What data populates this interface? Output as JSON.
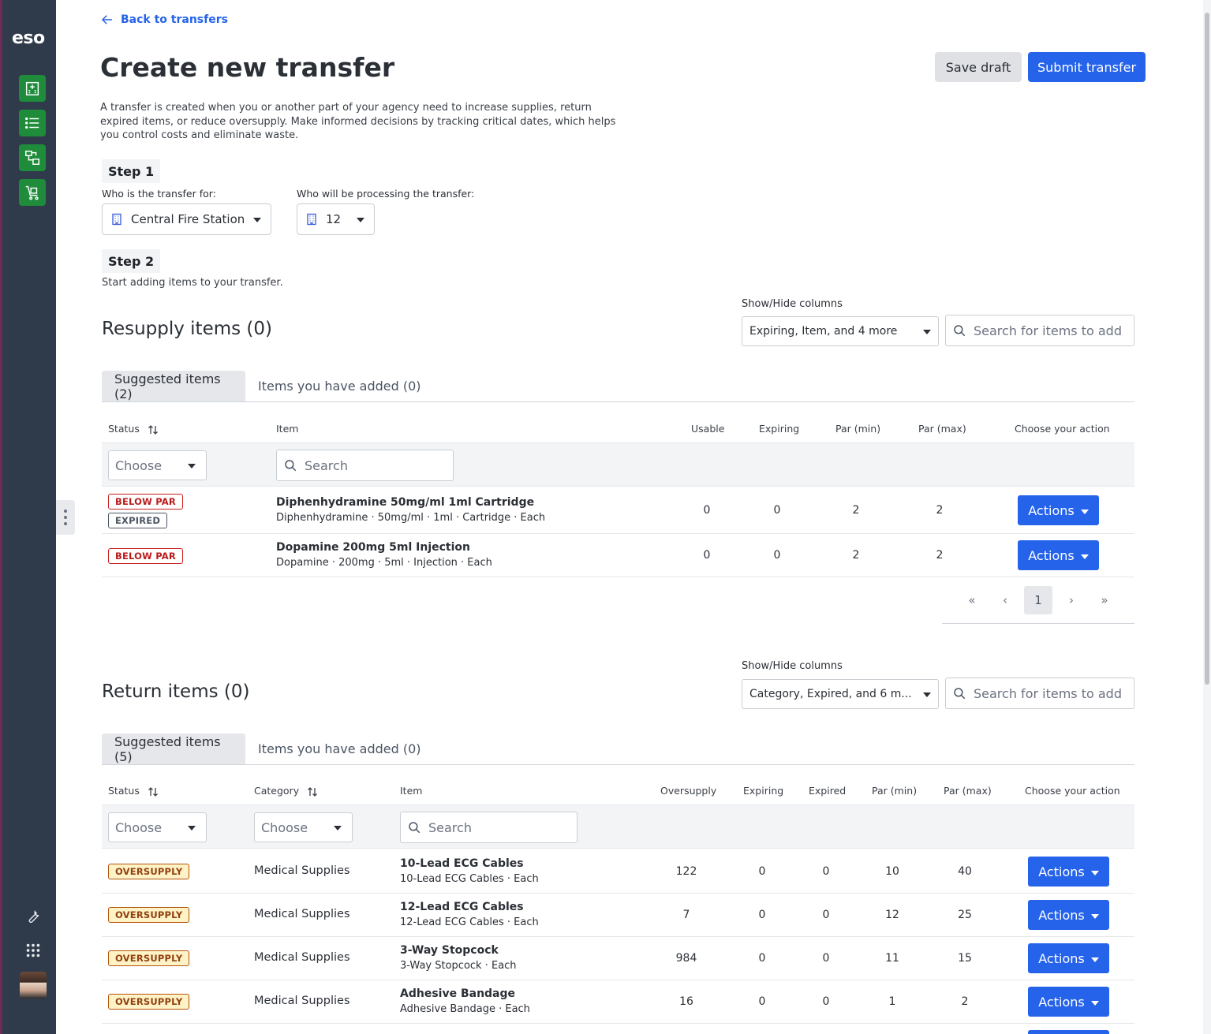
{
  "brand": {
    "logo_text": "eso",
    "accent": "#2563eb",
    "nav_green": "#1e8c3a",
    "rail_bg": "#2f3b4a"
  },
  "nav": [
    {
      "icon": "hospital-icon"
    },
    {
      "icon": "list-icon"
    },
    {
      "icon": "transfer-icon"
    },
    {
      "icon": "cart-icon"
    }
  ],
  "bottom_nav": [
    {
      "icon": "wrench-icon"
    },
    {
      "icon": "apps-grid-icon"
    },
    {
      "icon": "user-avatar"
    }
  ],
  "header": {
    "back_label": "Back to transfers",
    "title": "Create new transfer",
    "save_label": "Save draft",
    "submit_label": "Submit transfer",
    "intro": "A transfer is created when you or another part of your agency need to increase supplies, return expired items, or reduce oversupply. Make informed decisions by tracking critical dates, which helps you control costs and eliminate waste."
  },
  "step1": {
    "label": "Step 1",
    "for_label": "Who is the transfer for:",
    "for_value": "Central Fire Station",
    "processing_label": "Who will be processing the transfer:",
    "processing_value": "12"
  },
  "step2": {
    "label": "Step 2",
    "desc": "Start adding items to your transfer."
  },
  "resupply": {
    "title": "Resupply items (0)",
    "show_hide_label": "Show/Hide columns",
    "show_hide_value": "Expiring, Item, and 4 more",
    "search_placeholder": "Search for items to add",
    "tabs": [
      {
        "label": "Suggested items (2)",
        "active": true
      },
      {
        "label": "Items you have added (0)",
        "active": false
      }
    ],
    "columns": {
      "status": "Status",
      "item": "Item",
      "usable": "Usable",
      "expiring": "Expiring",
      "par_min": "Par (min)",
      "par_max": "Par (max)",
      "action": "Choose your action"
    },
    "filter": {
      "status_placeholder": "Choose",
      "item_placeholder": "Search"
    },
    "rows": [
      {
        "badges": [
          "BELOW PAR",
          "EXPIRED"
        ],
        "name": "Diphenhydramine 50mg/ml 1ml Cartridge",
        "desc": "Diphenhydramine · 50mg/ml · 1ml · Cartridge · Each",
        "usable": "0",
        "expiring": "0",
        "par_min": "2",
        "par_max": "2",
        "action": "Actions"
      },
      {
        "badges": [
          "BELOW PAR"
        ],
        "name": "Dopamine 200mg 5ml Injection",
        "desc": "Dopamine · 200mg · 5ml · Injection · Each",
        "usable": "0",
        "expiring": "0",
        "par_min": "2",
        "par_max": "2",
        "action": "Actions"
      }
    ],
    "pager": {
      "first": "«",
      "prev": "‹",
      "current": "1",
      "next": "›",
      "last": "»"
    }
  },
  "returns": {
    "title": "Return items (0)",
    "show_hide_label": "Show/Hide columns",
    "show_hide_value": "Category, Expired, and 6 m...",
    "search_placeholder": "Search for items to add",
    "tabs": [
      {
        "label": "Suggested items (5)",
        "active": true
      },
      {
        "label": "Items you have added (0)",
        "active": false
      }
    ],
    "columns": {
      "status": "Status",
      "category": "Category",
      "item": "Item",
      "oversupply": "Oversupply",
      "expiring": "Expiring",
      "expired": "Expired",
      "par_min": "Par (min)",
      "par_max": "Par (max)",
      "action": "Choose your action"
    },
    "filter": {
      "status_placeholder": "Choose",
      "category_placeholder": "Choose",
      "item_placeholder": "Search"
    },
    "rows": [
      {
        "badge": "OVERSUPPLY",
        "category": "Medical Supplies",
        "name": "10-Lead ECG Cables",
        "desc": "10-Lead ECG Cables · Each",
        "oversupply": "122",
        "expiring": "0",
        "expired": "0",
        "par_min": "10",
        "par_max": "40",
        "action": "Actions"
      },
      {
        "badge": "OVERSUPPLY",
        "category": "Medical Supplies",
        "name": "12-Lead ECG Cables",
        "desc": "12-Lead ECG Cables · Each",
        "oversupply": "7",
        "expiring": "0",
        "expired": "0",
        "par_min": "12",
        "par_max": "25",
        "action": "Actions"
      },
      {
        "badge": "OVERSUPPLY",
        "category": "Medical Supplies",
        "name": "3-Way Stopcock",
        "desc": "3-Way Stopcock · Each",
        "oversupply": "984",
        "expiring": "0",
        "expired": "0",
        "par_min": "11",
        "par_max": "15",
        "action": "Actions"
      },
      {
        "badge": "OVERSUPPLY",
        "category": "Medical Supplies",
        "name": "Adhesive Bandage",
        "desc": "Adhesive Bandage · Each",
        "oversupply": "16",
        "expiring": "0",
        "expired": "0",
        "par_min": "1",
        "par_max": "2",
        "action": "Actions"
      }
    ]
  }
}
